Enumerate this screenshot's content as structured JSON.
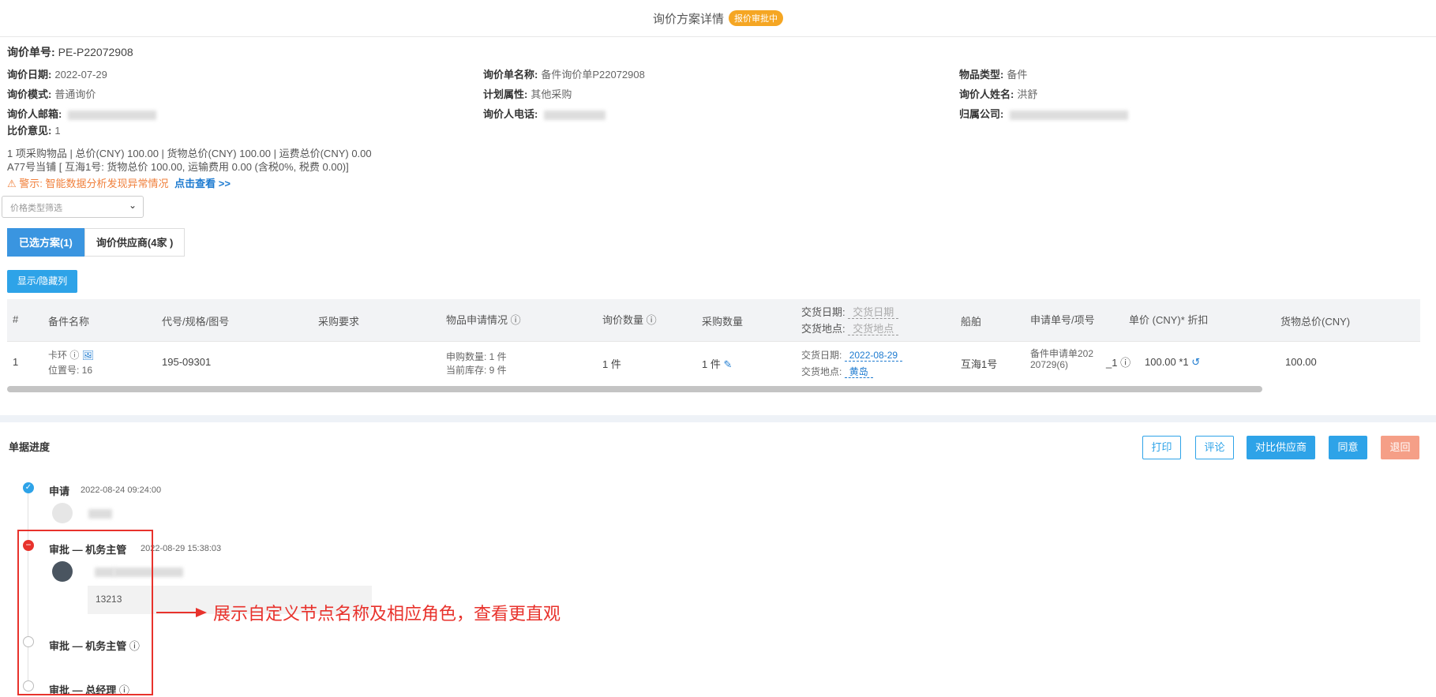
{
  "header": {
    "title": "询价方案详情",
    "badge": "报价审批中"
  },
  "info": {
    "inquiry_no_label": "询价单号:",
    "inquiry_no": "PE-P22072908",
    "date_label": "询价日期:",
    "date": "2022-07-29",
    "name_label": "询价单名称:",
    "name": "备件询价单P22072908",
    "type_label": "物品类型:",
    "type": "备件",
    "mode_label": "询价模式:",
    "mode": "普通询价",
    "plan_label": "计划属性:",
    "plan": "其他采购",
    "person_label": "询价人姓名:",
    "person": "洪舒",
    "email_label": "询价人邮箱:",
    "phone_label": "询价人电话:",
    "company_label": "归属公司:",
    "opinion_label": "比价意见:",
    "opinion": "1"
  },
  "summary": {
    "line1": "1 项采购物品   |   总价(CNY)  100.00   |   货物总价(CNY)  100.00   |   运费总价(CNY)  0.00",
    "line2": "A77号当铺 [ 互海1号: 货物总价  100.00, 运输费用  0.00 (含税0%, 税费  0.00)]"
  },
  "warning": {
    "text": "警示: 智能数据分析发现异常情况",
    "link": "点击查看 >>"
  },
  "filter": {
    "placeholder": "价格类型筛选"
  },
  "tabs": [
    {
      "label": "已选方案(1)"
    },
    {
      "label": "询价供应商(4家 )"
    }
  ],
  "show_hide_button": "显示/隐藏列",
  "table": {
    "headers": {
      "index": "#",
      "part_name": "备件名称",
      "code": "代号/规格/图号",
      "requirement": "采购要求",
      "apply_status": "物品申请情况",
      "inquiry_qty": "询价数量",
      "purchase_qty": "采购数量",
      "delivery_date_label": "交货日期:",
      "delivery_date_ph": "交货日期",
      "delivery_place_label": "交货地点:",
      "delivery_place_ph": "交货地点",
      "ship": "船舶",
      "apply_no": "申请单号/项号",
      "unit_price": "单价 (CNY)* 折扣",
      "total": "货物总价(CNY)"
    },
    "row": {
      "index": "1",
      "part_name": "卡环",
      "position": "位置号:  16",
      "code": "195-09301",
      "apply_qty": "申购数量:  1 件",
      "stock": "当前库存:  9 件",
      "inquiry_qty": "1 件",
      "purchase_qty": "1 件",
      "delivery_date_label": "交货日期:",
      "delivery_date": "2022-08-29",
      "delivery_place_label": "交货地点:",
      "delivery_place": "黄岛",
      "ship": "互海1号",
      "apply_no_1": "备件申请单202",
      "apply_no_2": "20729(6)",
      "apply_item": "_1",
      "unit_price": "100.00 *1",
      "total": "100.00"
    }
  },
  "progress": {
    "title": "单据进度",
    "buttons": {
      "print": "打印",
      "comment": "评论",
      "compare": "对比供应商",
      "agree": "同意",
      "return": "退回"
    },
    "steps": [
      {
        "title": "申请",
        "time": "2022-08-24 09:24:00"
      },
      {
        "title": "审批 — 机务主管",
        "time": "2022-08-29 15:38:03",
        "comment": "13213"
      },
      {
        "title": "审批 — 机务主管"
      },
      {
        "title": "审批 — 总经理"
      }
    ]
  },
  "annotation": "展示自定义节点名称及相应角色，查看更直观",
  "colors": {
    "primary": "#2ea3e8",
    "badge": "#f5a623",
    "warning": "#f0803c",
    "danger": "#e8322c",
    "return": "#f59f87"
  }
}
